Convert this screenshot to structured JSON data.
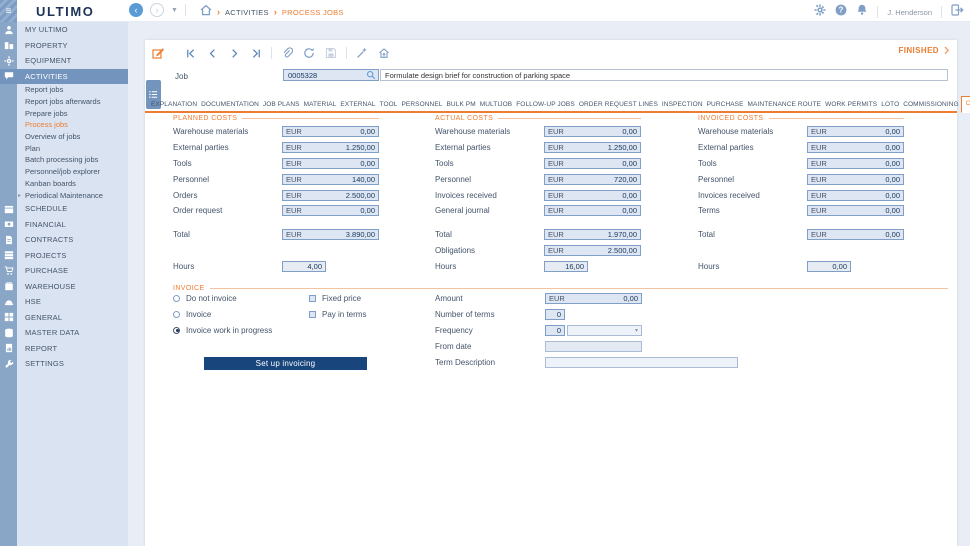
{
  "colors": {
    "accent_orange": "#ed7d31",
    "navy": "#17457c",
    "strip_blue": "#8aa6c7",
    "selected_blue": "#7394bd",
    "sidebar_bg": "#d9e3f1",
    "field_bg": "#dde6f2",
    "field_border": "#7f9fc6"
  },
  "topbar": {
    "logo": "ULTIMO",
    "breadcrumb": {
      "items": [
        "ACTIVITIES",
        "PROCESS JOBS"
      ]
    },
    "user": "J. Henderson",
    "icons": [
      "hamburger-icon",
      "back-icon",
      "forward-icon",
      "dropdown-caret-icon",
      "home-icon",
      "settings-gear-icon",
      "help-icon",
      "notifications-bell-icon",
      "logout-icon"
    ]
  },
  "sidebar": {
    "top_items": [
      {
        "label": "MY ULTIMO",
        "icon": "user",
        "active": false
      },
      {
        "label": "PROPERTY",
        "icon": "building",
        "active": false
      },
      {
        "label": "EQUIPMENT",
        "icon": "gear",
        "active": false
      },
      {
        "label": "ACTIVITIES",
        "icon": "chat",
        "active": true
      }
    ],
    "sub_items": [
      {
        "label": "Report jobs",
        "active": false
      },
      {
        "label": "Report jobs afterwards",
        "active": false
      },
      {
        "label": "Prepare jobs",
        "active": false
      },
      {
        "label": "Process jobs",
        "active": true
      },
      {
        "label": "Overview of jobs",
        "active": false
      },
      {
        "label": "Plan",
        "active": false
      },
      {
        "label": "Batch processing jobs",
        "active": false
      },
      {
        "label": "Personnel/job explorer",
        "active": false
      },
      {
        "label": "Kanban boards",
        "active": false
      },
      {
        "label": "Periodical Maintenance",
        "active": false,
        "expandable": true
      }
    ],
    "bottom_items": [
      {
        "label": "SCHEDULE",
        "icon": "calendar"
      },
      {
        "label": "FINANCIAL",
        "icon": "money"
      },
      {
        "label": "CONTRACTS",
        "icon": "contract"
      },
      {
        "label": "PROJECTS",
        "icon": "cards"
      },
      {
        "label": "PURCHASE",
        "icon": "cart"
      },
      {
        "label": "WAREHOUSE",
        "icon": "box"
      },
      {
        "label": "HSE",
        "icon": "hardhat"
      },
      {
        "label": "GENERAL",
        "icon": "grid"
      },
      {
        "label": "MASTER DATA",
        "icon": "database"
      },
      {
        "label": "REPORT",
        "icon": "report"
      },
      {
        "label": "SETTINGS",
        "icon": "wrench"
      }
    ]
  },
  "record": {
    "status": "FINISHED",
    "job_label": "Job",
    "job_code": "0005328",
    "job_description": "Formulate design brief for construction of parking space"
  },
  "tabs": {
    "items": [
      "EXPLANATION",
      "DOCUMENTATION",
      "JOB PLANS",
      "MATERIAL",
      "EXTERNAL",
      "TOOL",
      "PERSONNEL",
      "BULK PM",
      "MULTIJOB",
      "FOLLOW-UP JOBS",
      "ORDER REQUEST LINES",
      "INSPECTION",
      "PURCHASE",
      "MAINTENANCE ROUTE",
      "WORK PERMITS",
      "LOTO",
      "COMMISSIONING",
      "COSTS"
    ],
    "active": "COSTS"
  },
  "costs": {
    "planned": {
      "title": "PLANNED COSTS",
      "rows": [
        {
          "label": "Warehouse materials",
          "currency": "EUR",
          "value": "0,00"
        },
        {
          "label": "External parties",
          "currency": "EUR",
          "value": "1.250,00"
        },
        {
          "label": "Tools",
          "currency": "EUR",
          "value": "0,00"
        },
        {
          "label": "Personnel",
          "currency": "EUR",
          "value": "140,00"
        },
        {
          "label": "Orders",
          "currency": "EUR",
          "value": "2.500,00"
        },
        {
          "label": "Order request",
          "currency": "EUR",
          "value": "0,00"
        }
      ],
      "total": {
        "label": "Total",
        "currency": "EUR",
        "value": "3.890,00"
      },
      "hours": {
        "label": "Hours",
        "value": "4,00"
      }
    },
    "actual": {
      "title": "ACTUAL COSTS",
      "rows": [
        {
          "label": "Warehouse materials",
          "currency": "EUR",
          "value": "0,00"
        },
        {
          "label": "External parties",
          "currency": "EUR",
          "value": "1.250,00"
        },
        {
          "label": "Tools",
          "currency": "EUR",
          "value": "0,00"
        },
        {
          "label": "Personnel",
          "currency": "EUR",
          "value": "720,00"
        },
        {
          "label": "Invoices received",
          "currency": "EUR",
          "value": "0,00"
        },
        {
          "label": "General journal",
          "currency": "EUR",
          "value": "0,00"
        }
      ],
      "total": {
        "label": "Total",
        "currency": "EUR",
        "value": "1.970,00"
      },
      "obligations": {
        "label": "Obligations",
        "currency": "EUR",
        "value": "2.500,00"
      },
      "hours": {
        "label": "Hours",
        "value": "16,00"
      }
    },
    "invoiced": {
      "title": "INVOICED COSTS",
      "rows": [
        {
          "label": "Warehouse materials",
          "currency": "EUR",
          "value": "0,00"
        },
        {
          "label": "External parties",
          "currency": "EUR",
          "value": "0,00"
        },
        {
          "label": "Tools",
          "currency": "EUR",
          "value": "0,00"
        },
        {
          "label": "Personnel",
          "currency": "EUR",
          "value": "0,00"
        },
        {
          "label": "Invoices received",
          "currency": "EUR",
          "value": "0,00"
        },
        {
          "label": "Terms",
          "currency": "EUR",
          "value": "0,00"
        }
      ],
      "total": {
        "label": "Total",
        "currency": "EUR",
        "value": "0,00"
      },
      "hours": {
        "label": "Hours",
        "value": "0,00"
      }
    }
  },
  "invoice": {
    "title": "INVOICE",
    "radios": [
      {
        "label": "Do not invoice",
        "selected": false
      },
      {
        "label": "Invoice",
        "selected": false
      },
      {
        "label": "Invoice work in progress",
        "selected": true
      }
    ],
    "checkboxes": [
      {
        "label": "Fixed price",
        "checked": false
      },
      {
        "label": "Pay in terms",
        "checked": false
      }
    ],
    "amount": {
      "label": "Amount",
      "currency": "EUR",
      "value": "0,00"
    },
    "number_of_terms": {
      "label": "Number of terms",
      "value": "0"
    },
    "frequency": {
      "label": "Frequency",
      "value": "0",
      "selected_option": ""
    },
    "from_date": {
      "label": "From date",
      "value": ""
    },
    "term_description": {
      "label": "Term Description",
      "value": ""
    },
    "setup_button": "Set up invoicing"
  }
}
